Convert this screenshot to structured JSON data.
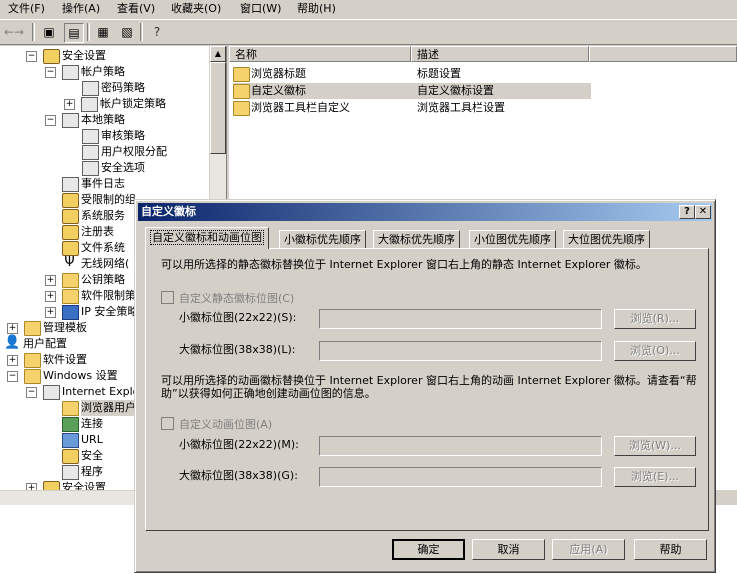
{
  "menu": [
    "文件(F)",
    "操作(A)",
    "查看(V)",
    "收藏夹(O)",
    "窗口(W)",
    "帮助(H)"
  ],
  "tree": {
    "items": [
      {
        "label": "安全设置"
      },
      {
        "label": "帐户策略"
      },
      {
        "label": "密码策略"
      },
      {
        "label": "帐户锁定策略"
      },
      {
        "label": "本地策略"
      },
      {
        "label": "审核策略"
      },
      {
        "label": "用户权限分配"
      },
      {
        "label": "安全选项"
      },
      {
        "label": "事件日志"
      },
      {
        "label": "受限制的组"
      },
      {
        "label": "系统服务"
      },
      {
        "label": "注册表"
      },
      {
        "label": "文件系统"
      },
      {
        "label": "无线网络("
      },
      {
        "label": "公钥策略"
      },
      {
        "label": "软件限制策"
      },
      {
        "label": "IP 安全策略"
      },
      {
        "label": "管理模板"
      },
      {
        "label": "用户配置"
      },
      {
        "label": "软件设置"
      },
      {
        "label": "Windows 设置"
      },
      {
        "label": "Internet Explor"
      },
      {
        "label": "浏览器用户"
      },
      {
        "label": "连接"
      },
      {
        "label": "URL"
      },
      {
        "label": "安全"
      },
      {
        "label": "程序"
      },
      {
        "label": "安全设置"
      }
    ]
  },
  "list": {
    "col_name": "名称",
    "col_desc": "描述",
    "rows": [
      {
        "name": "浏览器标题",
        "desc": "标题设置"
      },
      {
        "name": "自定义徽标",
        "desc": "自定义徽标设置"
      },
      {
        "name": "浏览器工具栏自定义",
        "desc": "浏览器工具栏设置"
      }
    ]
  },
  "dialog": {
    "title": "自定义徽标",
    "help_btn": "?",
    "close_btn": "✕",
    "tabs": [
      "自定义徽标和动画位图",
      "小徽标优先顺序",
      "大徽标优先顺序",
      "小位图优先顺序",
      "大位图优先顺序"
    ],
    "static_desc": "可以用所选择的静态徽标替换位于 Internet Explorer 窗口右上角的静态 Internet Explorer 徽标。",
    "static_check": "自定义静态徽标位图(C)",
    "small_logo_label": "小徽标位图(22x22)(S):",
    "large_logo_label": "大徽标位图(38x38)(L):",
    "browse_r": "浏览(R)...",
    "browse_o": "浏览(O)...",
    "animated_desc": "可以用所选择的动画徽标替换位于 Internet Explorer 窗口右上角的动画 Internet Explorer 徽标。请查看“帮助”以获得如何正确地创建动画位图的信息。",
    "animated_check": "自定义动画位图(A)",
    "small_bmp_label": "小徽标位图(22x22)(M):",
    "large_bmp_label": "大徽标位图(38x38)(G):",
    "browse_w": "浏览(W)...",
    "browse_e": "浏览(E)...",
    "ok": "确定",
    "cancel": "取消",
    "apply": "应用(A)",
    "help": "帮助"
  }
}
